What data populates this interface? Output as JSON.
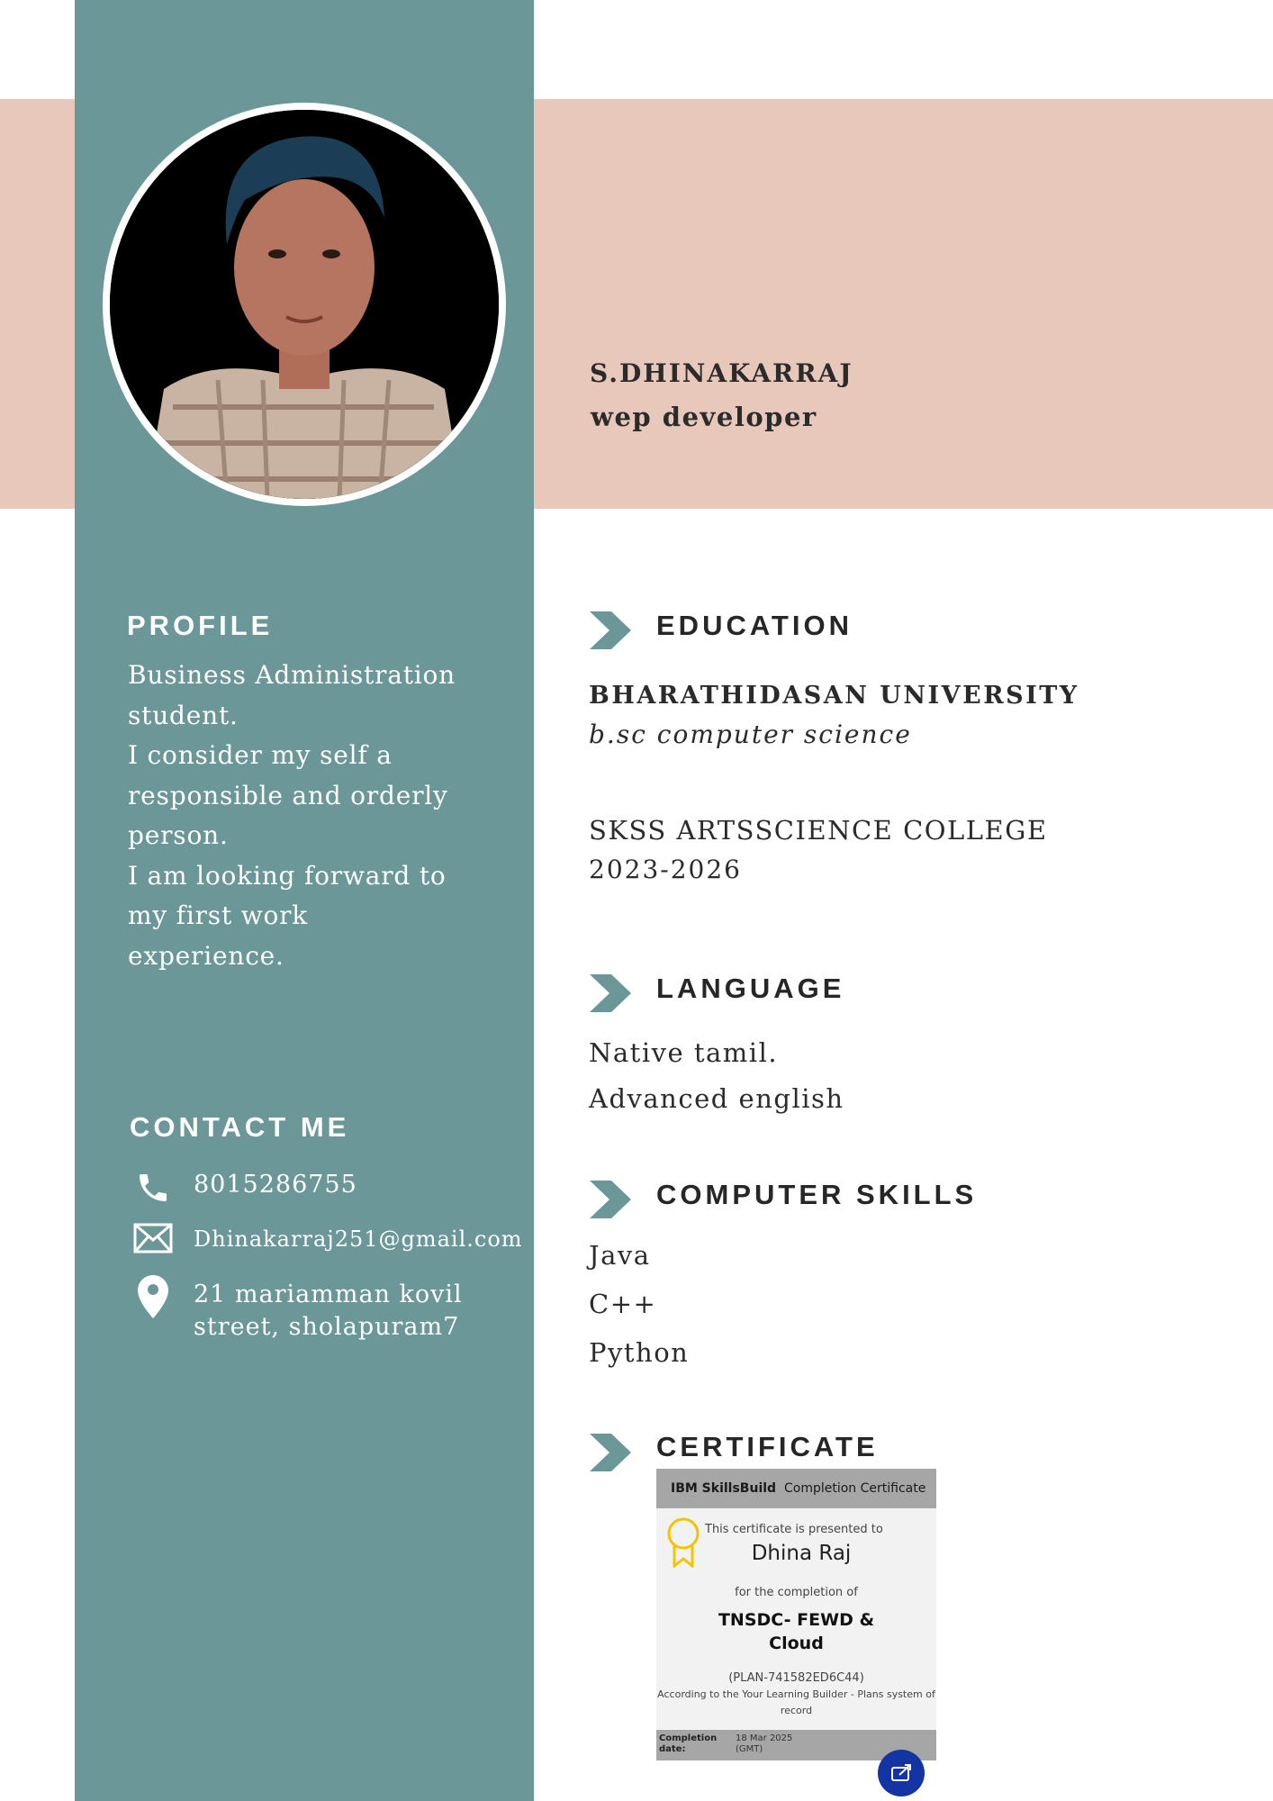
{
  "colors": {
    "sidebar": "#6b9799",
    "header_band": "#e8c8ba",
    "text_dark": "#2b2b2b",
    "white": "#ffffff"
  },
  "header": {
    "name": "S.DHINAKARRAJ",
    "role": "wep developer"
  },
  "profile": {
    "title": "PROFILE",
    "lines": [
      "Business Administration",
      "student.",
      "I consider my self a",
      "responsible and orderly",
      "person.",
      "I am looking forward to",
      "my first work",
      "experience."
    ]
  },
  "contact": {
    "title": "CONTACT ME",
    "phone": "8015286755",
    "email": "Dhinakarraj251@gmail.com",
    "address_line1": "21 mariamman kovil",
    "address_line2": "street, sholapuram7",
    "icons": [
      "phone-icon",
      "mail-icon",
      "location-pin-icon"
    ]
  },
  "education": {
    "title": "EDUCATION",
    "university": "BHARATHIDASAN UNIVERSITY",
    "degree": "b.sc computer science",
    "college": "SKSS ARTSSCIENCE COLLEGE",
    "years": "2023-2026"
  },
  "language": {
    "title": "LANGUAGE",
    "items": [
      "Native tamil.",
      "Advanced english"
    ]
  },
  "skills": {
    "title": "COMPUTER SKILLS",
    "items": [
      "Java",
      "C++",
      "Python"
    ]
  },
  "certificate": {
    "title": "CERTIFICATE",
    "brand": "IBM SkillsBuild",
    "header_text": "Completion Certificate",
    "presented": "This certificate is presented to",
    "recipient": "Dhina Raj",
    "completion_of": "for the completion of",
    "course_line1": "TNSDC- FEWD &",
    "course_line2": "Cloud",
    "plan": "(PLAN-741582ED6C44)",
    "according_line1": "According to the Your Learning Builder - Plans system of",
    "according_line2": "record",
    "completion_label": "Completion date:",
    "completion_date": "18 Mar 2025",
    "timezone": "(GMT)"
  }
}
